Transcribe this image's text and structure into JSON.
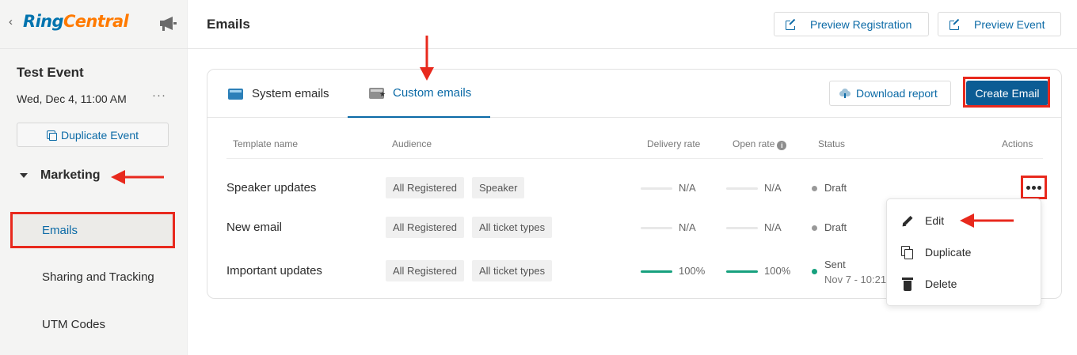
{
  "sidebar": {
    "back_icon": "‹",
    "logo": {
      "part1": "Ring",
      "part2": "Central"
    },
    "megaphone_icon": "megaphone-icon",
    "event_title": "Test Event",
    "event_date": "Wed, Dec 4, 11:00 AM",
    "more_icon": "···",
    "duplicate_button": "Duplicate Event",
    "section_label": "Marketing",
    "nav": {
      "emails": "Emails",
      "sharing": "Sharing and Tracking",
      "utm": "UTM Codes"
    }
  },
  "header": {
    "title": "Emails",
    "preview_registration": "Preview Registration",
    "preview_event": "Preview Event"
  },
  "tabs": {
    "system": "System emails",
    "custom": "Custom emails",
    "active": "custom"
  },
  "toolbar": {
    "download_report": "Download report",
    "create_email": "Create Email"
  },
  "table": {
    "columns": {
      "template": "Template name",
      "audience": "Audience",
      "delivery": "Delivery rate",
      "open": "Open rate",
      "status": "Status",
      "actions": "Actions"
    },
    "rows": [
      {
        "name": "Speaker updates",
        "audience": [
          "All Registered",
          "Speaker"
        ],
        "delivery": "N/A",
        "open": "N/A",
        "status": "Draft"
      },
      {
        "name": "New email",
        "audience": [
          "All Registered",
          "All ticket types"
        ],
        "delivery": "N/A",
        "open": "N/A",
        "status": "Draft"
      },
      {
        "name": "Important updates",
        "audience": [
          "All Registered",
          "All ticket types"
        ],
        "delivery": "100%",
        "open": "100%",
        "status": "Sent",
        "status_date": "Nov 7 - 10:21"
      }
    ]
  },
  "menu": {
    "edit": "Edit",
    "duplicate": "Duplicate",
    "delete": "Delete"
  },
  "colors": {
    "accent": "#0b6aa6",
    "primary_button": "#0b5c94",
    "annotation_red": "#e8291d",
    "success_green": "#17a17e",
    "sidebar_bg": "#f4f4f3"
  }
}
